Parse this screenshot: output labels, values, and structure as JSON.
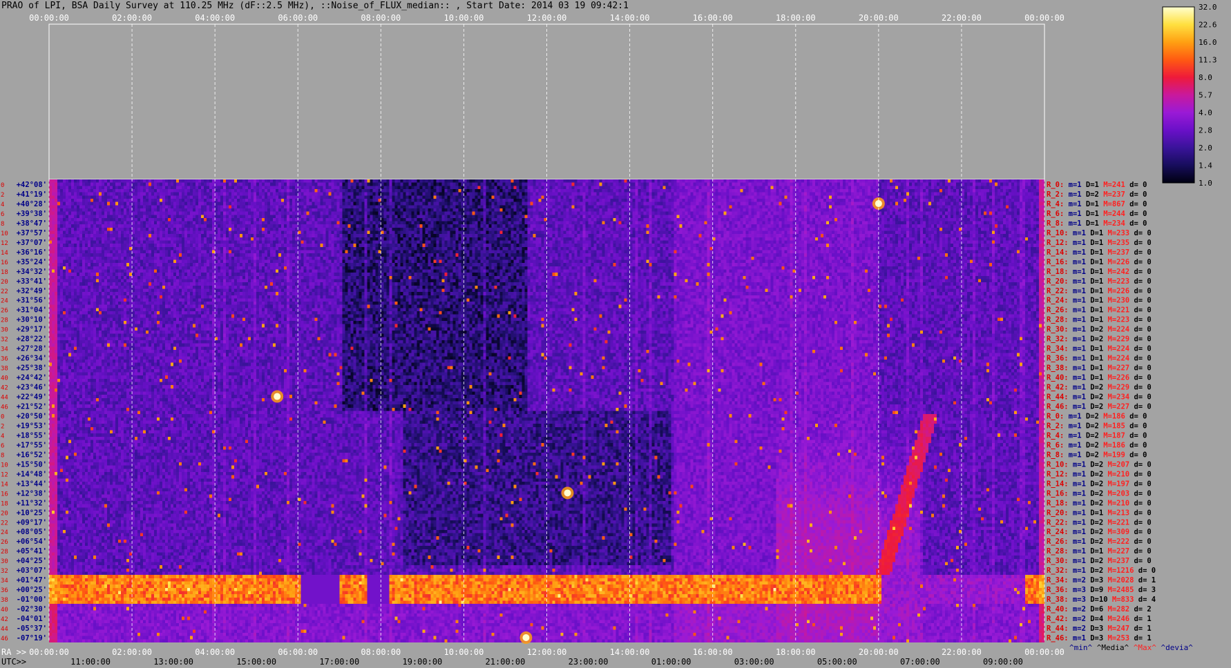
{
  "title": "PRAO of LPI, BSA Daily Survey at 110.25 MHz (dF::2.5 MHz), ::Noise_of_FLUX_median:: , Start Date: 2014 03 19 09:42:1",
  "chart_data": {
    "type": "heatmap",
    "top_axis_ticks": [
      "00:00:00",
      "02:00:00",
      "04:00:00",
      "06:00:00",
      "08:00:00",
      "10:00:00",
      "12:00:00",
      "14:00:00",
      "16:00:00",
      "18:00:00",
      "20:00:00",
      "22:00:00",
      "00:00:00"
    ],
    "ra_axis_label": "RA >>",
    "ra_ticks": [
      "00:00:00",
      "02:00:00",
      "04:00:00",
      "06:00:00",
      "08:00:00",
      "10:00:00",
      "12:00:00",
      "14:00:00",
      "16:00:00",
      "18:00:00",
      "20:00:00",
      "22:00:00",
      "00:00:00"
    ],
    "utc_axis_label": "UTC>>",
    "utc_ticks": [
      "11:00:00",
      "13:00:00",
      "15:00:00",
      "17:00:00",
      "19:00:00",
      "21:00:00",
      "23:00:00",
      "01:00:00",
      "03:00:00",
      "05:00:00",
      "07:00:00",
      "09:00:00"
    ],
    "row_indices": [
      "0",
      "2",
      "4",
      "6",
      "8",
      "10",
      "12",
      "14",
      "16",
      "18",
      "20",
      "22",
      "24",
      "26",
      "28",
      "30",
      "32",
      "34",
      "36",
      "38",
      "40",
      "42",
      "44",
      "46",
      "0",
      "2",
      "4",
      "6",
      "8",
      "10",
      "12",
      "14",
      "16",
      "18",
      "20",
      "22",
      "24",
      "26",
      "28",
      "30",
      "32",
      "34",
      "36",
      "38",
      "40",
      "42",
      "44",
      "46"
    ],
    "declinations": [
      "+42°08'",
      "+41°19'",
      "+40°28'",
      "+39°38'",
      "+38°47'",
      "+37°57'",
      "+37°07'",
      "+36°16'",
      "+35°24'",
      "+34°32'",
      "+33°41'",
      "+32°49'",
      "+31°56'",
      "+31°04'",
      "+30°10'",
      "+29°17'",
      "+28°22'",
      "+27°28'",
      "+26°34'",
      "+25°38'",
      "+24°42'",
      "+23°46'",
      "+22°49'",
      "+21°52'",
      "+20°50'",
      "+19°53'",
      "+18°55'",
      "+17°55'",
      "+16°52'",
      "+15°50'",
      "+14°48'",
      "+13°44'",
      "+12°38'",
      "+11°32'",
      "+10°25'",
      "+09°17'",
      "+08°05'",
      "+06°54'",
      "+05°41'",
      "+04°25'",
      "+03°07'",
      "+01°47'",
      "+00°25'",
      "-01°00'",
      "-02°30'",
      "-04°01'",
      "-05°37'",
      "-07°19'"
    ],
    "row_stats": [
      {
        "beam": "R_0:",
        "m": "m=1",
        "D": "D=1",
        "M": "M=241",
        "d": "d= 0"
      },
      {
        "beam": "R_2:",
        "m": "m=1",
        "D": "D=2",
        "M": "M=237",
        "d": "d= 0"
      },
      {
        "beam": "R_4:",
        "m": "m=1",
        "D": "D=1",
        "M": "M=867",
        "d": "d= 0"
      },
      {
        "beam": "R_6:",
        "m": "m=1",
        "D": "D=1",
        "M": "M=244",
        "d": "d= 0"
      },
      {
        "beam": "R_8:",
        "m": "m=1",
        "D": "D=1",
        "M": "M=234",
        "d": "d= 0"
      },
      {
        "beam": "R_10:",
        "m": "m=1",
        "D": "D=1",
        "M": "M=233",
        "d": "d= 0"
      },
      {
        "beam": "R_12:",
        "m": "m=1",
        "D": "D=1",
        "M": "M=235",
        "d": "d= 0"
      },
      {
        "beam": "R_14:",
        "m": "m=1",
        "D": "D=1",
        "M": "M=237",
        "d": "d= 0"
      },
      {
        "beam": "R_16:",
        "m": "m=1",
        "D": "D=1",
        "M": "M=226",
        "d": "d= 0"
      },
      {
        "beam": "R_18:",
        "m": "m=1",
        "D": "D=1",
        "M": "M=242",
        "d": "d= 0"
      },
      {
        "beam": "R_20:",
        "m": "m=1",
        "D": "D=1",
        "M": "M=223",
        "d": "d= 0"
      },
      {
        "beam": "R_22:",
        "m": "m=1",
        "D": "D=1",
        "M": "M=226",
        "d": "d= 0"
      },
      {
        "beam": "R_24:",
        "m": "m=1",
        "D": "D=1",
        "M": "M=230",
        "d": "d= 0"
      },
      {
        "beam": "R_26:",
        "m": "m=1",
        "D": "D=1",
        "M": "M=221",
        "d": "d= 0"
      },
      {
        "beam": "R_28:",
        "m": "m=1",
        "D": "D=1",
        "M": "M=223",
        "d": "d= 0"
      },
      {
        "beam": "R_30:",
        "m": "m=1",
        "D": "D=2",
        "M": "M=224",
        "d": "d= 0"
      },
      {
        "beam": "R_32:",
        "m": "m=1",
        "D": "D=2",
        "M": "M=229",
        "d": "d= 0"
      },
      {
        "beam": "R_34:",
        "m": "m=1",
        "D": "D=1",
        "M": "M=224",
        "d": "d= 0"
      },
      {
        "beam": "R_36:",
        "m": "m=1",
        "D": "D=1",
        "M": "M=224",
        "d": "d= 0"
      },
      {
        "beam": "R_38:",
        "m": "m=1",
        "D": "D=1",
        "M": "M=227",
        "d": "d= 0"
      },
      {
        "beam": "R_40:",
        "m": "m=1",
        "D": "D=1",
        "M": "M=226",
        "d": "d= 0"
      },
      {
        "beam": "R_42:",
        "m": "m=1",
        "D": "D=2",
        "M": "M=229",
        "d": "d= 0"
      },
      {
        "beam": "R_44:",
        "m": "m=1",
        "D": "D=2",
        "M": "M=234",
        "d": "d= 0"
      },
      {
        "beam": "R_46:",
        "m": "m=1",
        "D": "D=2",
        "M": "M=227",
        "d": "d= 0"
      },
      {
        "beam": "R_0:",
        "m": "m=1",
        "D": "D=2",
        "M": "M=186",
        "d": "d= 0"
      },
      {
        "beam": "R_2:",
        "m": "m=1",
        "D": "D=2",
        "M": "M=185",
        "d": "d= 0"
      },
      {
        "beam": "R_4:",
        "m": "m=1",
        "D": "D=2",
        "M": "M=187",
        "d": "d= 0"
      },
      {
        "beam": "R_6:",
        "m": "m=1",
        "D": "D=2",
        "M": "M=186",
        "d": "d= 0"
      },
      {
        "beam": "R_8:",
        "m": "m=1",
        "D": "D=2",
        "M": "M=199",
        "d": "d= 0"
      },
      {
        "beam": "R_10:",
        "m": "m=1",
        "D": "D=2",
        "M": "M=207",
        "d": "d= 0"
      },
      {
        "beam": "R_12:",
        "m": "m=1",
        "D": "D=2",
        "M": "M=210",
        "d": "d= 0"
      },
      {
        "beam": "R_14:",
        "m": "m=1",
        "D": "D=2",
        "M": "M=197",
        "d": "d= 0"
      },
      {
        "beam": "R_16:",
        "m": "m=1",
        "D": "D=2",
        "M": "M=203",
        "d": "d= 0"
      },
      {
        "beam": "R_18:",
        "m": "m=1",
        "D": "D=2",
        "M": "M=210",
        "d": "d= 0"
      },
      {
        "beam": "R_20:",
        "m": "m=1",
        "D": "D=1",
        "M": "M=213",
        "d": "d= 0"
      },
      {
        "beam": "R_22:",
        "m": "m=1",
        "D": "D=2",
        "M": "M=221",
        "d": "d= 0"
      },
      {
        "beam": "R_24:",
        "m": "m=1",
        "D": "D=2",
        "M": "M=309",
        "d": "d= 0"
      },
      {
        "beam": "R_26:",
        "m": "m=1",
        "D": "D=2",
        "M": "M=222",
        "d": "d= 0"
      },
      {
        "beam": "R_28:",
        "m": "m=1",
        "D": "D=1",
        "M": "M=227",
        "d": "d= 0"
      },
      {
        "beam": "R_30:",
        "m": "m=1",
        "D": "D=2",
        "M": "M=237",
        "d": "d= 0"
      },
      {
        "beam": "R_32:",
        "m": "m=1",
        "D": "D=2",
        "M": "M=1216",
        "d": "d= 0"
      },
      {
        "beam": "R_34:",
        "m": "m=2",
        "D": "D=3",
        "M": "M=2028",
        "d": "d= 1"
      },
      {
        "beam": "R_36:",
        "m": "m=3",
        "D": "D=9",
        "M": "M=2485",
        "d": "d= 3"
      },
      {
        "beam": "R_38:",
        "m": "m=3",
        "D": "D=10",
        "M": "M=833",
        "d": "d= 4"
      },
      {
        "beam": "R_40:",
        "m": "m=2",
        "D": "D=6",
        "M": "M=282",
        "d": "d= 2"
      },
      {
        "beam": "R_42:",
        "m": "m=2",
        "D": "D=4",
        "M": "M=246",
        "d": "d= 1"
      },
      {
        "beam": "R_44:",
        "m": "m=2",
        "D": "D=3",
        "M": "M=247",
        "d": "d= 1"
      },
      {
        "beam": "R_46:",
        "m": "m=1",
        "D": "D=3",
        "M": "M=253",
        "d": "d= 1"
      }
    ],
    "stats_legend": [
      "^min^",
      "^Media^",
      "^Max^",
      "^devia^"
    ],
    "colorbar": {
      "ticks": [
        "32.0",
        "22.6",
        "16.0",
        "11.3",
        "8.0",
        "5.7",
        "4.0",
        "2.8",
        "2.0",
        "1.4",
        "1.0"
      ],
      "vmin": 1.0,
      "vmax": 32.0,
      "scale": "log2",
      "colors": [
        "#000010",
        "#170d5c",
        "#3a139a",
        "#6a10c8",
        "#9a1ad6",
        "#c9199c",
        "#ee1a3a",
        "#ff5a12",
        "#ffa012",
        "#ffe040",
        "#ffffd0"
      ]
    },
    "colors": {
      "background": "#a3a3a3",
      "axis_text": "#ffffff",
      "dec_text": "#000088",
      "index_text": "#dd0000",
      "beam_text": "#dd0000",
      "grid": "#ffffff",
      "min_text": "#000088",
      "media_text": "#000000",
      "max_text": "#ff2020",
      "devia_text": "#000088"
    },
    "features": [
      {
        "name": "sun_strip",
        "ra_hours": [
          0,
          24
        ],
        "dec_rows": [
          41,
          43
        ],
        "level": 16
      },
      {
        "name": "bright_source",
        "ra_hours": 20.0,
        "dec": "+40°28'",
        "level": 32
      },
      {
        "name": "bright_source",
        "ra_hours": 5.5,
        "dec": "+22°49'",
        "level": 22
      },
      {
        "name": "bright_source",
        "ra_hours": 12.5,
        "dec": "+12°38'",
        "level": 22
      },
      {
        "name": "bright_source",
        "ra_hours": 11.5,
        "dec": "-07°19'",
        "level": 32
      }
    ]
  }
}
